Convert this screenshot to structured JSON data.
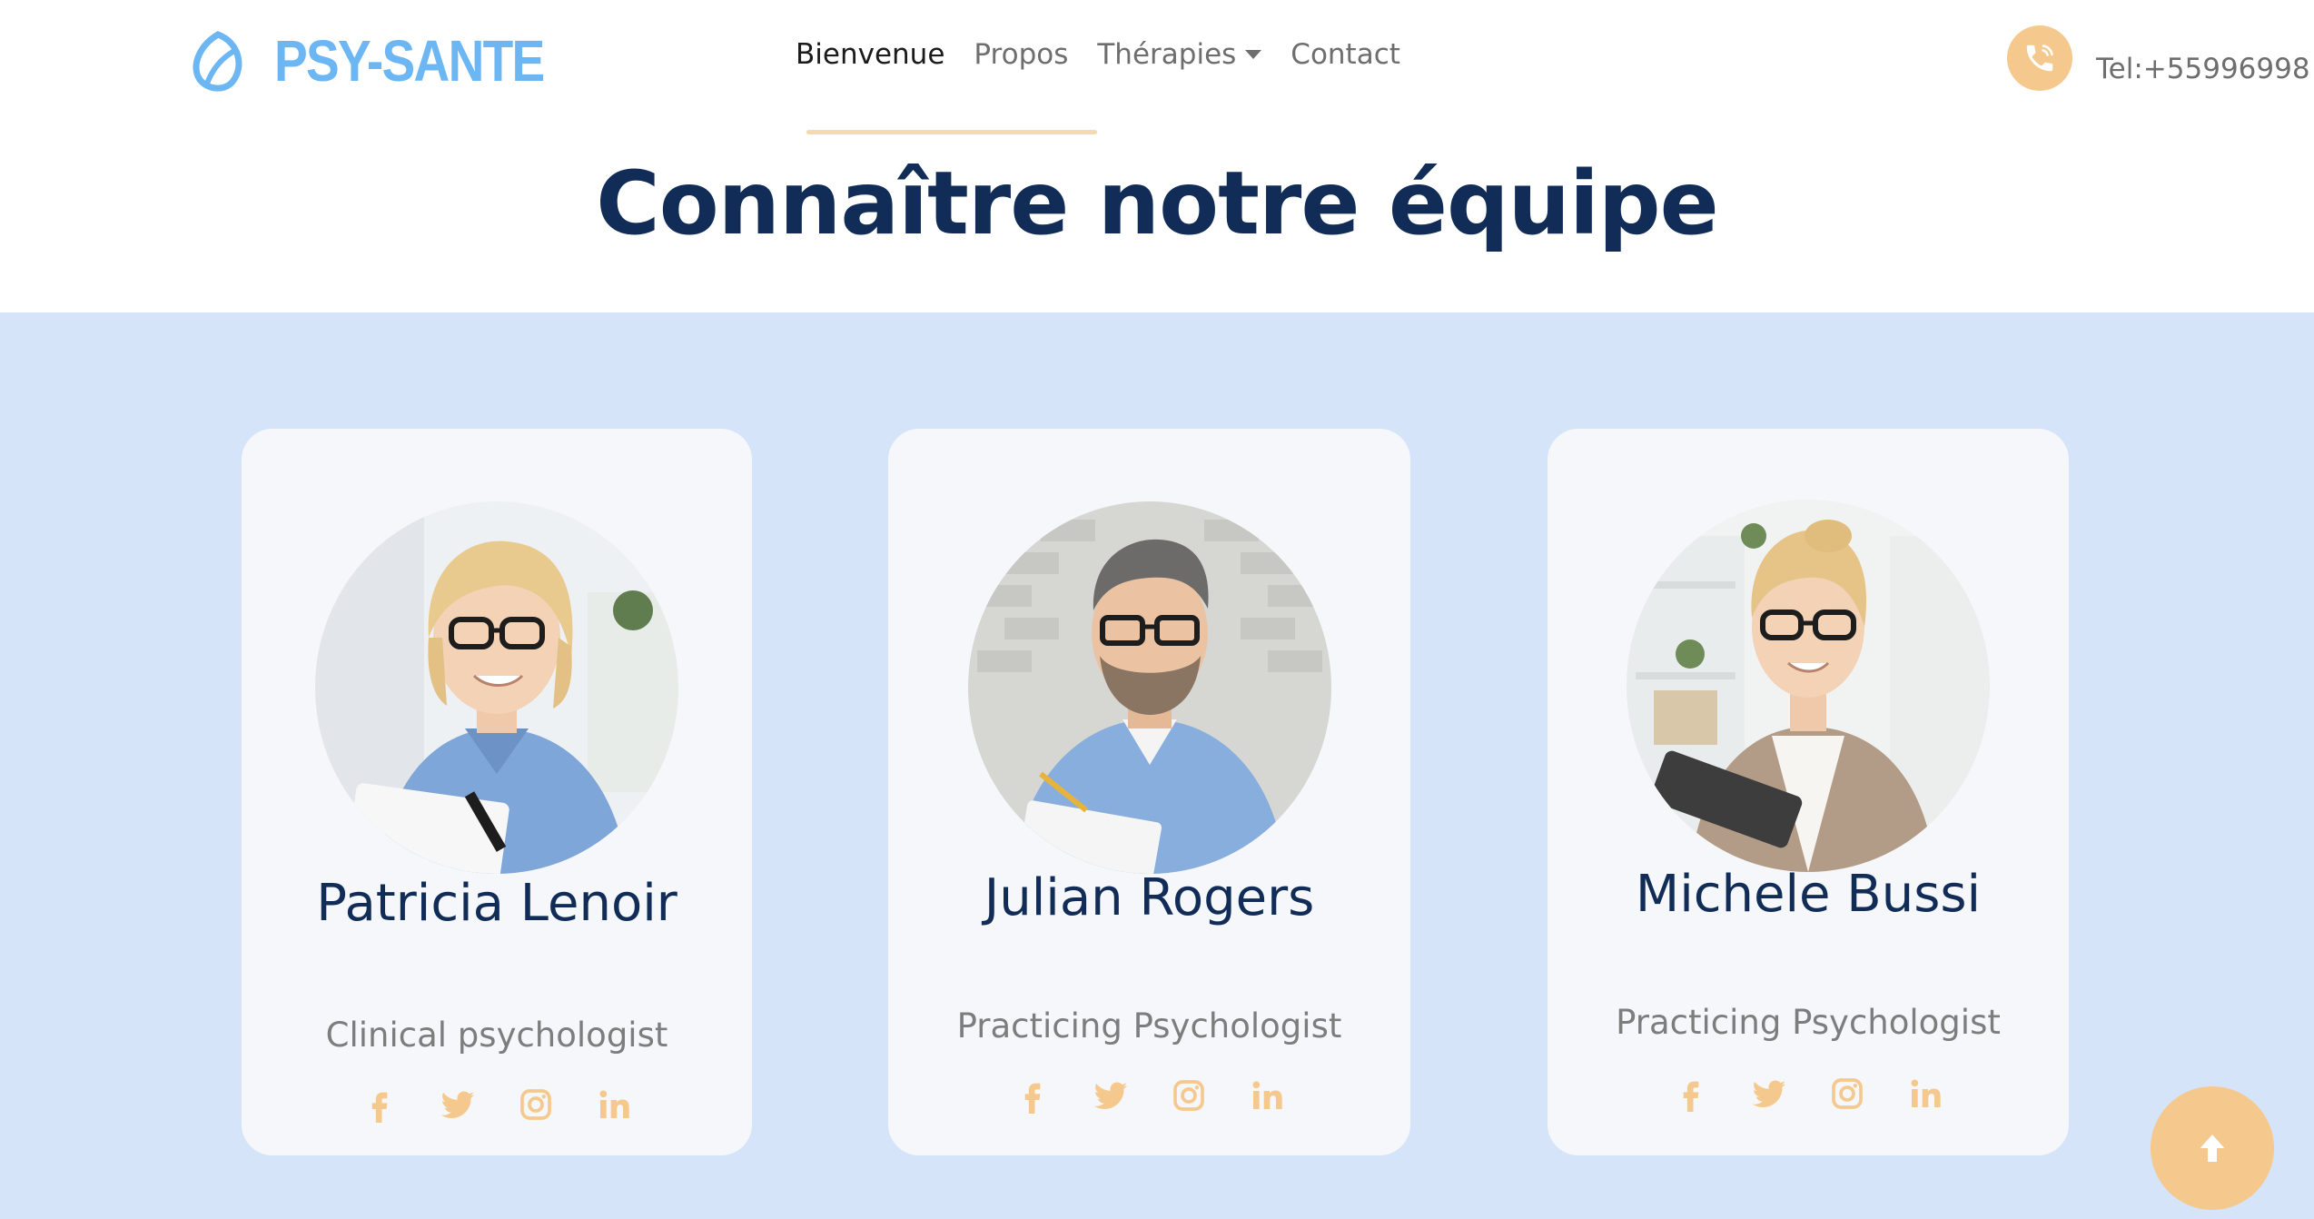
{
  "header": {
    "brand_name": "PSY-SANTE",
    "brand_icon": "leaf-logo-icon",
    "nav": [
      {
        "label": "Bienvenue",
        "active": true
      },
      {
        "label": "Propos",
        "active": false
      },
      {
        "label": "Thérapies",
        "active": false,
        "dropdown": true
      },
      {
        "label": "Contact",
        "active": false
      }
    ],
    "phone_icon": "phone-icon",
    "phone_text": "Tel:+55996998"
  },
  "section": {
    "title": "Connaître notre équipe"
  },
  "team": [
    {
      "name": "Patricia Lenoir",
      "role": "Clinical psychologist",
      "photo": "portrait-woman-blonde-short-hair"
    },
    {
      "name": "Julian Rogers",
      "role": "Practicing Psychologist",
      "photo": "portrait-man-glasses-beard"
    },
    {
      "name": "Michele Bussi",
      "role": "Practicing Psychologist",
      "photo": "portrait-woman-blonde-bun"
    }
  ],
  "social_icons": [
    "facebook-icon",
    "twitter-icon",
    "instagram-icon",
    "linkedin-icon"
  ],
  "scroll_top_icon": "arrow-up-icon",
  "colors": {
    "brand_blue": "#6cb6f4",
    "navy": "#112c57",
    "accent_peach": "#f5c98e",
    "band_blue": "#d5e4f9",
    "card_bg": "#f5f7fa",
    "muted_text": "#7d7d7d"
  }
}
